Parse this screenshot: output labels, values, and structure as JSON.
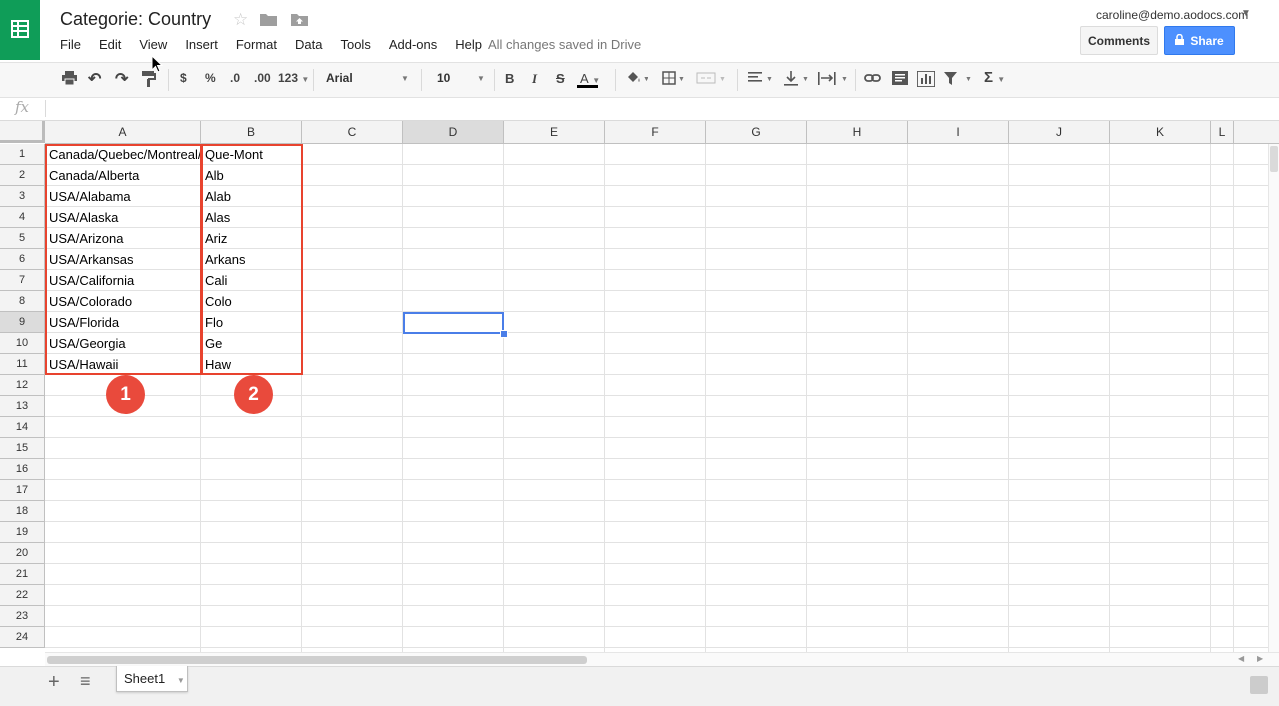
{
  "app": {
    "title": "Categorie: Country",
    "saved_status": "All changes saved in Drive"
  },
  "header_icons": [
    "star-icon",
    "folder-icon",
    "move-icon"
  ],
  "menu": [
    "File",
    "Edit",
    "View",
    "Insert",
    "Format",
    "Data",
    "Tools",
    "Add-ons",
    "Help"
  ],
  "user": {
    "email": "caroline@demo.aodocs.com"
  },
  "buttons": {
    "comments": "Comments",
    "share": "Share"
  },
  "toolbar": {
    "currency": "$",
    "percent": "%",
    "decrease_decimal": ".0",
    "increase_decimal": ".00",
    "more_formats": "123",
    "font": "Arial",
    "font_size": "10",
    "bold": "B",
    "italic": "I",
    "strikethrough": "S",
    "text_color": "A",
    "functions": "Σ"
  },
  "formula_bar": {
    "label": "fx",
    "value": ""
  },
  "columns": [
    "A",
    "B",
    "C",
    "D",
    "E",
    "F",
    "G",
    "H",
    "I",
    "J",
    "K",
    "L"
  ],
  "selected_column": "D",
  "rows": [
    "1",
    "2",
    "3",
    "4",
    "5",
    "6",
    "7",
    "8",
    "9",
    "10",
    "11",
    "12",
    "13",
    "14",
    "15",
    "16",
    "17",
    "18",
    "19",
    "20",
    "21",
    "22",
    "23",
    "24"
  ],
  "selected_row": "9",
  "cells": {
    "A": [
      "Canada/Quebec/Montreal/",
      "Canada/Alberta",
      "USA/Alabama",
      "USA/Alaska",
      "USA/Arizona",
      "USA/Arkansas",
      "USA/California",
      "USA/Colorado",
      "USA/Florida",
      "USA/Georgia",
      "USA/Hawaii"
    ],
    "B": [
      "Que-Mont",
      "Alb",
      "Alab",
      "Alas",
      "Ariz",
      "Arkans",
      "Cali",
      "Colo",
      "Flo",
      "Ge",
      "Haw"
    ]
  },
  "annotations": [
    {
      "label": "1"
    },
    {
      "label": "2"
    }
  ],
  "sheets": [
    {
      "name": "Sheet1"
    }
  ],
  "colors": {
    "brand": "#0f9d58",
    "share": "#4d90fe",
    "annotation": "#e8432e",
    "selection": "#4a7ee8"
  }
}
